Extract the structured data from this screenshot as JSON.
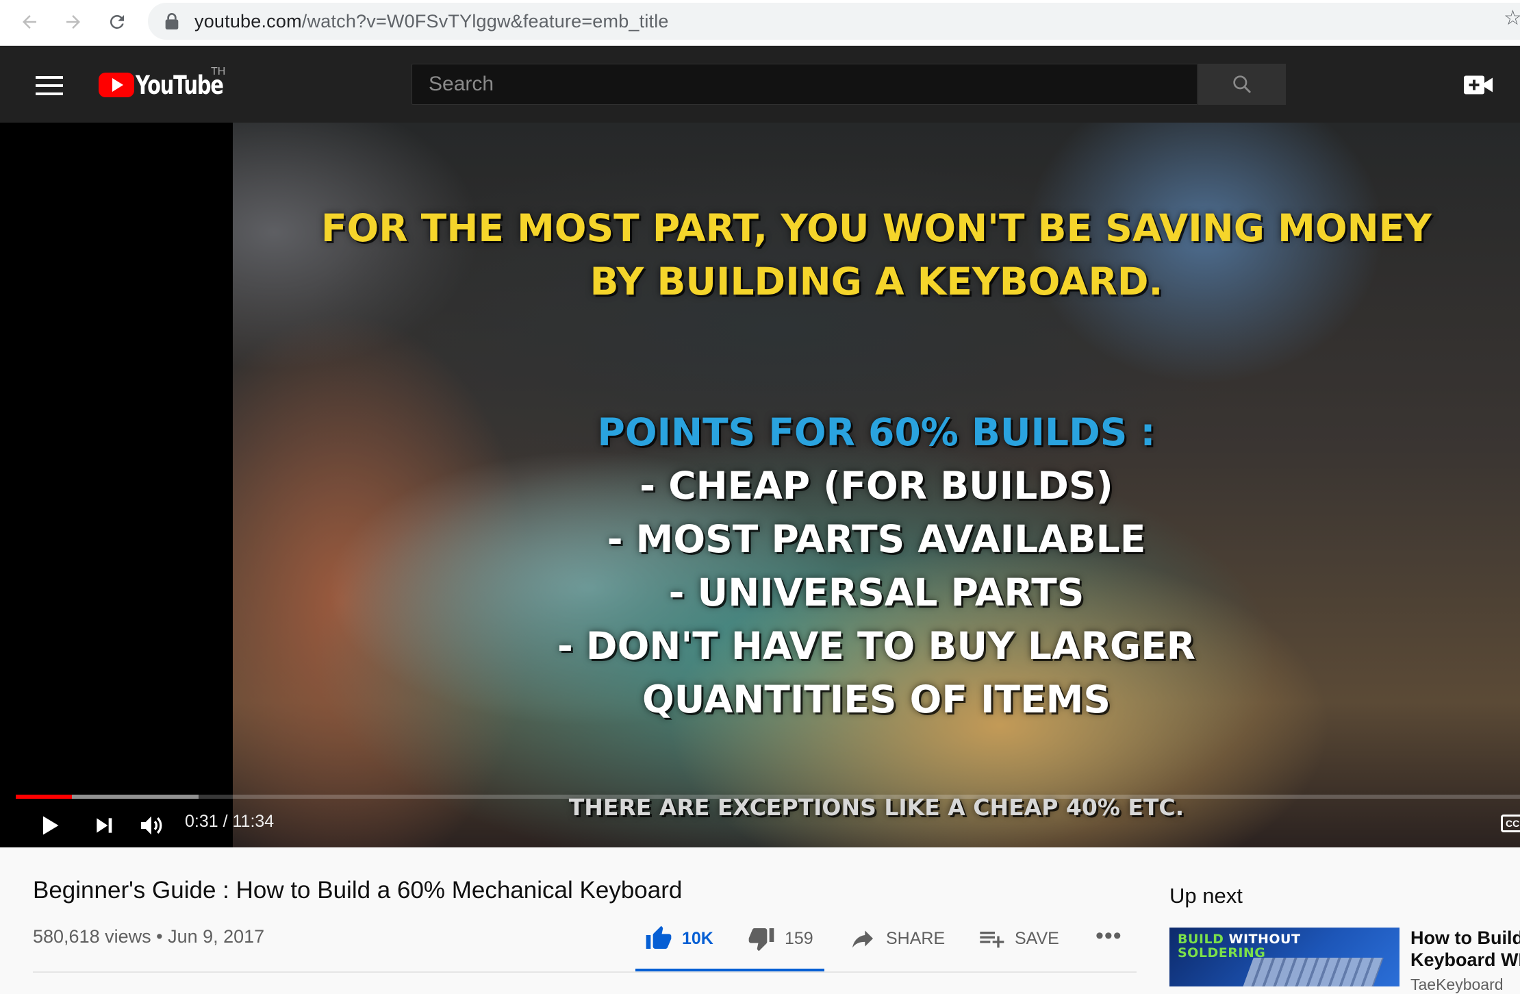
{
  "browser": {
    "url_host": "youtube.com",
    "url_rest": "/watch?v=W0FSvTYlggw&feature=emb_title"
  },
  "masthead": {
    "logo_text": "YouTube",
    "region": "TH",
    "search_placeholder": "Search"
  },
  "player": {
    "caption": {
      "line1": "FOR THE MOST PART, YOU WON'T BE SAVING MONEY",
      "line2": "BY BUILDING A KEYBOARD.",
      "points_heading": "POINTS FOR 60% BUILDS :",
      "points": [
        "- CHEAP (FOR BUILDS)",
        "- MOST PARTS AVAILABLE",
        "- UNIVERSAL PARTS",
        "- DON'T HAVE TO BUY LARGER",
        "QUANTITIES OF ITEMS"
      ],
      "footnote": "THERE ARE EXCEPTIONS LIKE A CHEAP 40% ETC."
    },
    "time_display": "0:31 / 11:34",
    "played_fraction": 0.0375,
    "loaded_fraction": 0.1215,
    "accent_color": "#ff0000"
  },
  "video": {
    "title": "Beginner's Guide : How to Build a 60% Mechanical Keyboard",
    "meta": "580,618 views • Jun 9, 2017",
    "actions": {
      "like_count": "10K",
      "dislike_count": "159",
      "share_label": "SHARE",
      "save_label": "SAVE"
    }
  },
  "sidebar": {
    "upnext_label": "Up next",
    "items": [
      {
        "thumb_line1_a": "BUILD",
        "thumb_line1_b": "WITHOUT",
        "thumb_line2": "SOLDERING",
        "title": "How to Build Keyboard WI",
        "channel": "TaeKeyboard"
      }
    ]
  }
}
